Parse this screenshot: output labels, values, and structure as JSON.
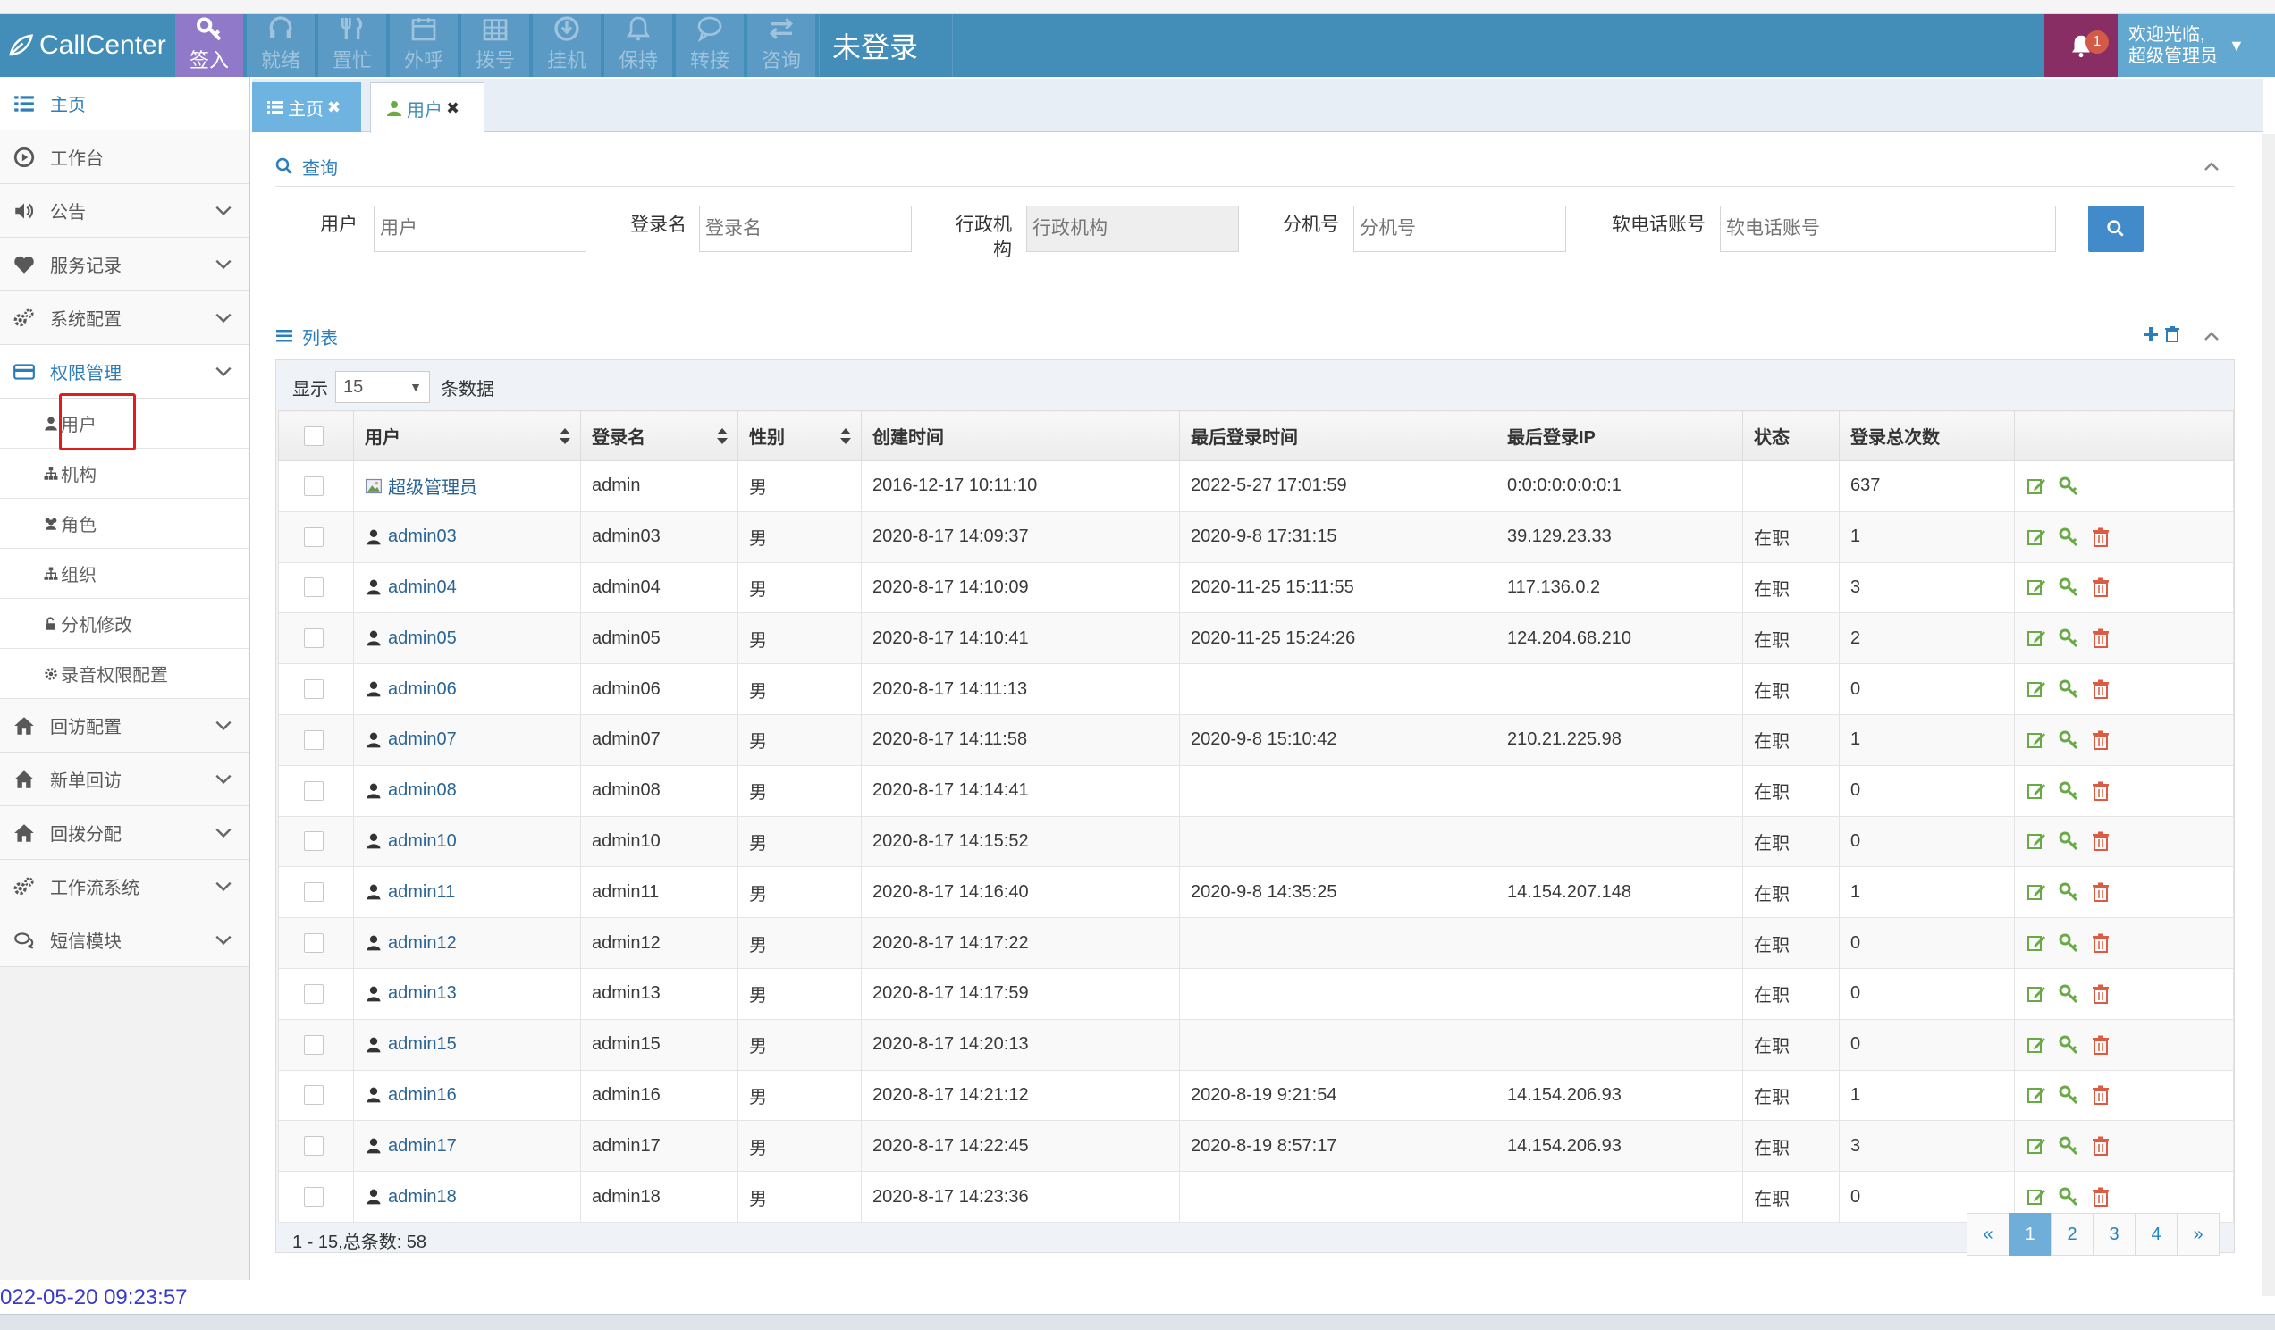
{
  "topbar": {
    "brand": "CallCenter",
    "tools": [
      {
        "label": "签入",
        "icon": "key-icon",
        "active": true
      },
      {
        "label": "就绪",
        "icon": "headset-icon",
        "active": false
      },
      {
        "label": "置忙",
        "icon": "fork-knife-icon",
        "active": false
      },
      {
        "label": "外呼",
        "icon": "calendar-icon",
        "active": false
      },
      {
        "label": "拨号",
        "icon": "keypad-icon",
        "active": false
      },
      {
        "label": "挂机",
        "icon": "download-circle-icon",
        "active": false
      },
      {
        "label": "保持",
        "icon": "bell-icon",
        "active": false
      },
      {
        "label": "转接",
        "icon": "chat-bubble-icon",
        "active": false
      },
      {
        "label": "咨询",
        "icon": "swap-arrows-icon",
        "active": false
      }
    ],
    "status": "未登录",
    "notification_count": "1",
    "user_greeting": "欢迎光临,",
    "user_name": "超级管理员"
  },
  "sidebar": {
    "items": [
      {
        "label": "主页",
        "icon": "list-icon"
      },
      {
        "label": "工作台",
        "icon": "play-circle-icon"
      },
      {
        "label": "公告",
        "icon": "volume-icon"
      },
      {
        "label": "服务记录",
        "icon": "heart-icon"
      },
      {
        "label": "系统配置",
        "icon": "cogs-icon"
      },
      {
        "label": "权限管理",
        "icon": "credit-card-icon"
      },
      {
        "label": "回访配置",
        "icon": "home-icon"
      },
      {
        "label": "新单回访",
        "icon": "home-icon"
      },
      {
        "label": "回拨分配",
        "icon": "home-icon"
      },
      {
        "label": "工作流系统",
        "icon": "cogs-icon"
      },
      {
        "label": "短信模块",
        "icon": "comments-icon"
      }
    ],
    "sub_items": [
      {
        "label": "用户",
        "icon": "user-icon"
      },
      {
        "label": "机构",
        "icon": "sitemap-icon"
      },
      {
        "label": "角色",
        "icon": "group-icon"
      },
      {
        "label": "组织",
        "icon": "sitemap-icon"
      },
      {
        "label": "分机修改",
        "icon": "unlock-icon"
      },
      {
        "label": "录音权限配置",
        "icon": "cog-icon"
      }
    ]
  },
  "tabs": [
    {
      "label": "主页"
    },
    {
      "label": "用户"
    }
  ],
  "query": {
    "title": "查询",
    "fields": [
      {
        "label": "用户",
        "placeholder": "用户"
      },
      {
        "label": "登录名",
        "placeholder": "登录名"
      },
      {
        "label_line1": "行政机",
        "label_line2": "构",
        "placeholder": "行政机构"
      },
      {
        "label": "分机号",
        "placeholder": "分机号"
      },
      {
        "label": "软电话账号",
        "placeholder": "软电话账号"
      }
    ]
  },
  "list": {
    "title": "列表",
    "show_prefix": "显示",
    "page_size": "15",
    "show_suffix": "条数据",
    "columns": [
      "用户",
      "登录名",
      "性别",
      "创建时间",
      "最后登录时间",
      "最后登录IP",
      "状态",
      "登录总次数"
    ],
    "rows": [
      {
        "user": "超级管理员",
        "login": "admin",
        "gender": "男",
        "created": "2016-12-17 10:11:10",
        "last_login": "2022-5-27 17:01:59",
        "ip": "0:0:0:0:0:0:0:1",
        "status": "",
        "count": "637",
        "deletable": false,
        "avatar": "image"
      },
      {
        "user": "admin03",
        "login": "admin03",
        "gender": "男",
        "created": "2020-8-17 14:09:37",
        "last_login": "2020-9-8 17:31:15",
        "ip": "39.129.23.33",
        "status": "在职",
        "count": "1",
        "deletable": true
      },
      {
        "user": "admin04",
        "login": "admin04",
        "gender": "男",
        "created": "2020-8-17 14:10:09",
        "last_login": "2020-11-25 15:11:55",
        "ip": "117.136.0.2",
        "status": "在职",
        "count": "3",
        "deletable": true
      },
      {
        "user": "admin05",
        "login": "admin05",
        "gender": "男",
        "created": "2020-8-17 14:10:41",
        "last_login": "2020-11-25 15:24:26",
        "ip": "124.204.68.210",
        "status": "在职",
        "count": "2",
        "deletable": true
      },
      {
        "user": "admin06",
        "login": "admin06",
        "gender": "男",
        "created": "2020-8-17 14:11:13",
        "last_login": "",
        "ip": "",
        "status": "在职",
        "count": "0",
        "deletable": true
      },
      {
        "user": "admin07",
        "login": "admin07",
        "gender": "男",
        "created": "2020-8-17 14:11:58",
        "last_login": "2020-9-8 15:10:42",
        "ip": "210.21.225.98",
        "status": "在职",
        "count": "1",
        "deletable": true
      },
      {
        "user": "admin08",
        "login": "admin08",
        "gender": "男",
        "created": "2020-8-17 14:14:41",
        "last_login": "",
        "ip": "",
        "status": "在职",
        "count": "0",
        "deletable": true
      },
      {
        "user": "admin10",
        "login": "admin10",
        "gender": "男",
        "created": "2020-8-17 14:15:52",
        "last_login": "",
        "ip": "",
        "status": "在职",
        "count": "0",
        "deletable": true
      },
      {
        "user": "admin11",
        "login": "admin11",
        "gender": "男",
        "created": "2020-8-17 14:16:40",
        "last_login": "2020-9-8 14:35:25",
        "ip": "14.154.207.148",
        "status": "在职",
        "count": "1",
        "deletable": true
      },
      {
        "user": "admin12",
        "login": "admin12",
        "gender": "男",
        "created": "2020-8-17 14:17:22",
        "last_login": "",
        "ip": "",
        "status": "在职",
        "count": "0",
        "deletable": true
      },
      {
        "user": "admin13",
        "login": "admin13",
        "gender": "男",
        "created": "2020-8-17 14:17:59",
        "last_login": "",
        "ip": "",
        "status": "在职",
        "count": "0",
        "deletable": true
      },
      {
        "user": "admin15",
        "login": "admin15",
        "gender": "男",
        "created": "2020-8-17 14:20:13",
        "last_login": "",
        "ip": "",
        "status": "在职",
        "count": "0",
        "deletable": true
      },
      {
        "user": "admin16",
        "login": "admin16",
        "gender": "男",
        "created": "2020-8-17 14:21:12",
        "last_login": "2020-8-19 9:21:54",
        "ip": "14.154.206.93",
        "status": "在职",
        "count": "1",
        "deletable": true
      },
      {
        "user": "admin17",
        "login": "admin17",
        "gender": "男",
        "created": "2020-8-17 14:22:45",
        "last_login": "2020-8-19 8:57:17",
        "ip": "14.154.206.93",
        "status": "在职",
        "count": "3",
        "deletable": true
      },
      {
        "user": "admin18",
        "login": "admin18",
        "gender": "男",
        "created": "2020-8-17 14:23:36",
        "last_login": "",
        "ip": "",
        "status": "在职",
        "count": "0",
        "deletable": true
      }
    ],
    "summary": "1 - 15,总条数: 58",
    "pages": [
      "«",
      "1",
      "2",
      "3",
      "4",
      "»"
    ],
    "current_page": "1"
  },
  "timestamp": "022-05-20 09:23:57",
  "colors": {
    "topbar": "#438eb9",
    "link": "#2a6496",
    "edit": "#69aa46",
    "delete": "#dd5a43",
    "accent": "#2b7dbc"
  }
}
